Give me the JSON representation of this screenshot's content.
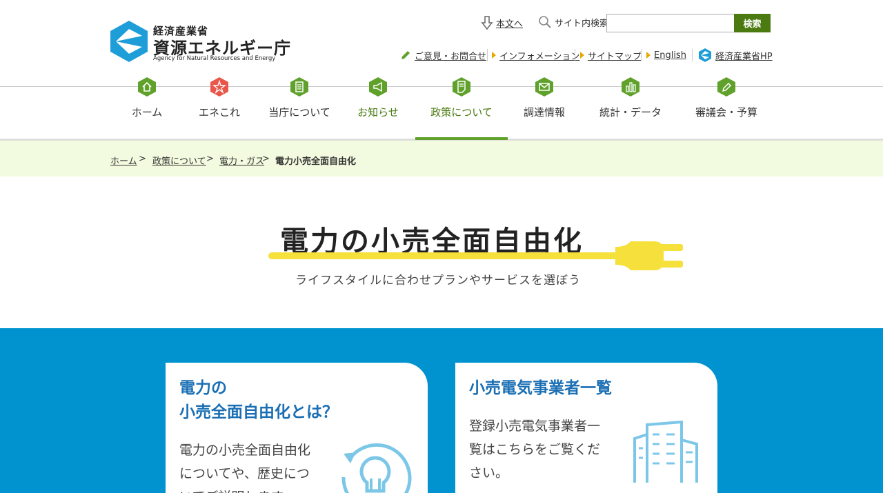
{
  "header": {
    "logo": {
      "ministry": "経済産業省",
      "agency": "資源エネルギー庁",
      "english": "Agency for Natural Resources and Energy"
    },
    "skip_link": "本文へ",
    "search": {
      "label": "サイト内検索",
      "placeholder": "",
      "button": "検索"
    },
    "utility_links": [
      "ご意見・お問合せ",
      "インフォメーション",
      "サイトマップ",
      "English",
      "経済産業省HP"
    ]
  },
  "nav": {
    "items": [
      {
        "label": "ホーム",
        "icon": "home-icon"
      },
      {
        "label": "エネこれ",
        "icon": "star-icon"
      },
      {
        "label": "当庁について",
        "icon": "building-icon"
      },
      {
        "label": "お知らせ",
        "icon": "megaphone-icon"
      },
      {
        "label": "政策について",
        "icon": "document-icon"
      },
      {
        "label": "調達情報",
        "icon": "envelope-icon"
      },
      {
        "label": "統計・データ",
        "icon": "bar-chart-icon"
      },
      {
        "label": "審議会・予算",
        "icon": "pencil-icon"
      }
    ],
    "active": "政策について"
  },
  "breadcrumb": [
    "ホーム",
    "政策について",
    "電力・ガス",
    "電力小売全面自由化"
  ],
  "hero": {
    "title": "電力の小売全面自由化",
    "subtitle": "ライフスタイルに合わせプランやサービスを選ぼう"
  },
  "cards": [
    {
      "title_line1": "電力の",
      "title_line2": "小売全面自由化とは？",
      "body_line1": "電力の小売全面自由化",
      "body_line2": "についてや、歴史につ",
      "body_line3": "いてご説明します"
    },
    {
      "title": "小売電気事業者一覧",
      "body_line1": "登録小売電気事業者一",
      "body_line2": "覧はこちらをご覧くだ",
      "body_line3": "さい。"
    }
  ],
  "colors": {
    "brand_green": "#4a7a10",
    "nav_icon_green": "#5fa12a",
    "nav_icon_red": "#e8574a",
    "section_blue": "#0093cf",
    "card_title_blue": "#1a6fb4",
    "plug_yellow": "#f5e03c"
  }
}
